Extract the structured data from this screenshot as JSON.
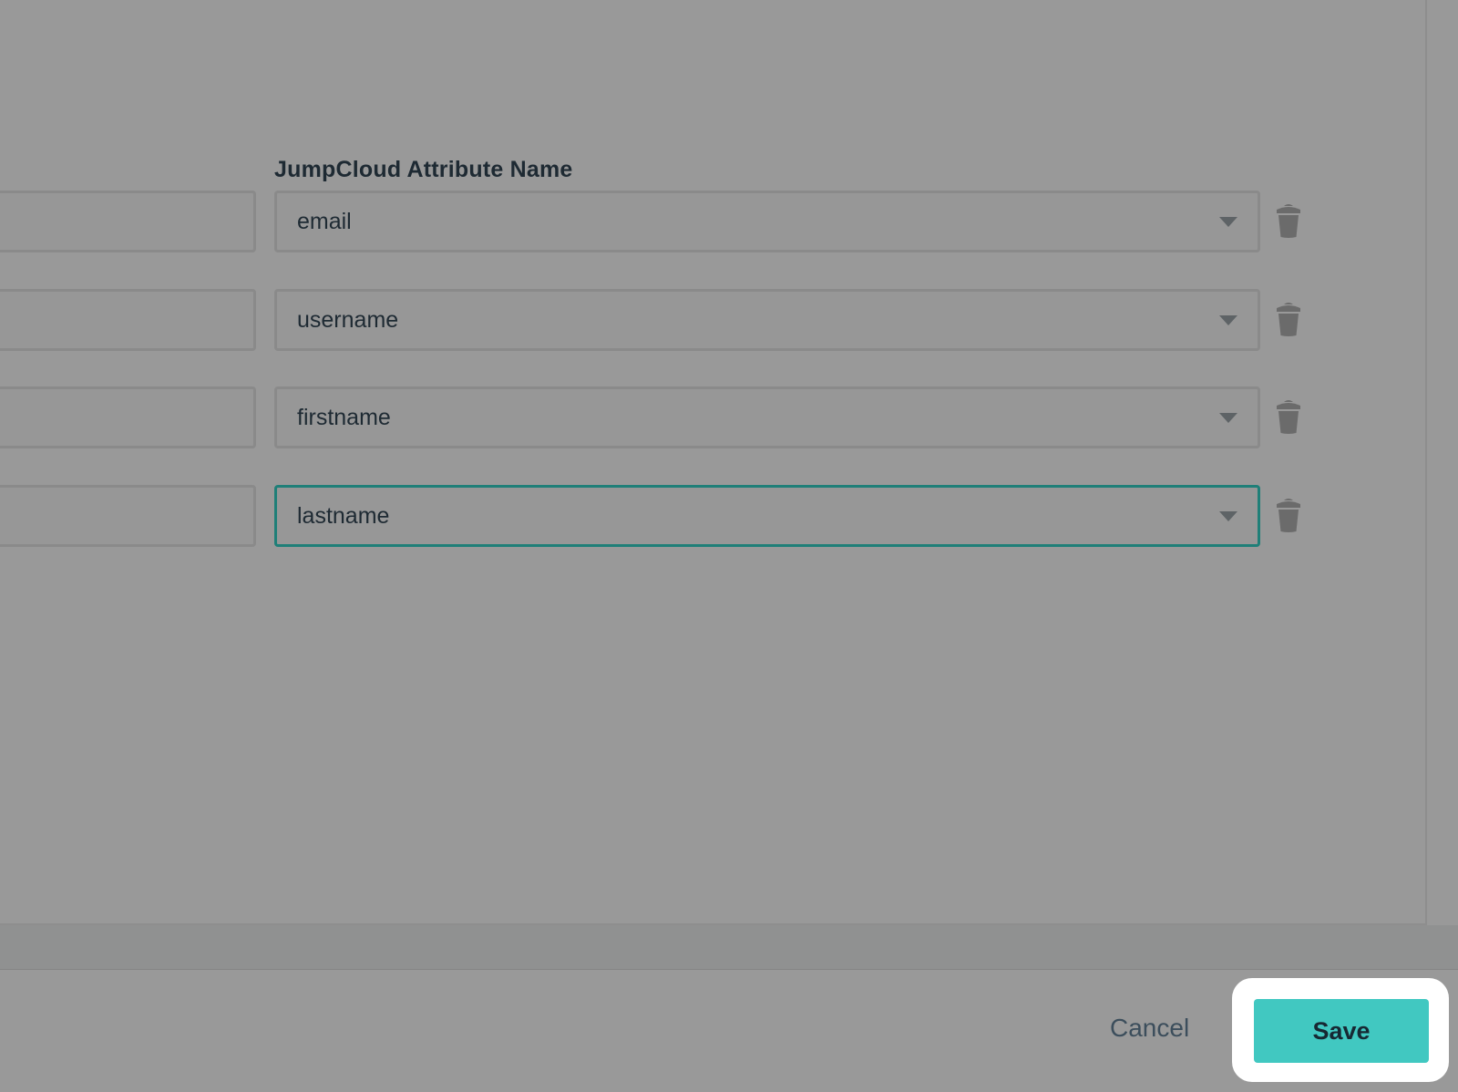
{
  "mapping": {
    "column_header": "JumpCloud Attribute Name",
    "rows": [
      {
        "attribute_value": "email",
        "source_value": ""
      },
      {
        "attribute_value": "username",
        "source_value": ""
      },
      {
        "attribute_value": "firstname",
        "source_value": ""
      },
      {
        "attribute_value": "lastname",
        "source_value": ""
      }
    ],
    "focused_row_index": 3
  },
  "footer": {
    "cancel_label": "Cancel",
    "save_label": "Save"
  },
  "icons": {
    "delete": "trash-icon",
    "dropdown": "chevron-down-icon"
  },
  "colors": {
    "accent": "#41c8c1",
    "focus_border": "#1f7f78",
    "overlay": "#999999"
  }
}
